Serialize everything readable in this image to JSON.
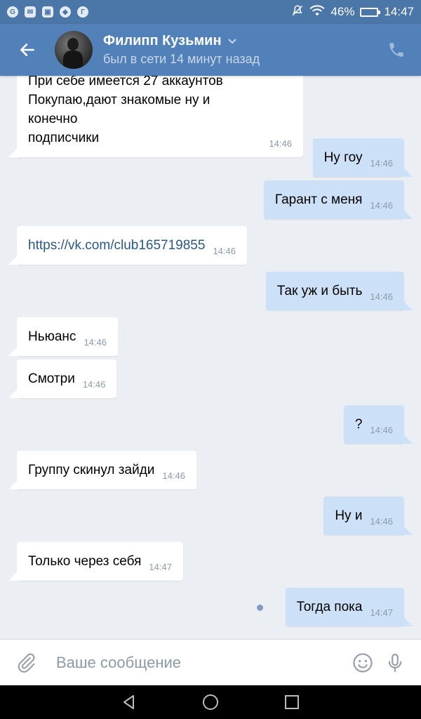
{
  "statusbar": {
    "apps": [
      "G",
      "✉",
      "▣",
      "◆",
      "Г"
    ],
    "battery": "46%",
    "battery_level": 0.46,
    "time": "14:47"
  },
  "header": {
    "name": "Филипп Кузьмин",
    "status": "был в сети 14 минут назад"
  },
  "messages": [
    {
      "dir": "in",
      "lines": [
        "При себе имеется 27 аккаунтов",
        "Покупаю,дают знакомые ну и конечно",
        "подписчики"
      ],
      "time": "14:46"
    },
    {
      "dir": "out",
      "text": "Ну гоу",
      "time": "14:46"
    },
    {
      "dir": "out",
      "text": "Гарант с меня",
      "time": "14:46"
    },
    {
      "dir": "in",
      "text": "https://vk.com/club165719855",
      "time": "14:46",
      "link": true
    },
    {
      "dir": "out",
      "text": "Так уж и быть",
      "time": "14:46"
    },
    {
      "dir": "in",
      "text": "Ньюанс",
      "time": "14:46"
    },
    {
      "dir": "in",
      "text": "Смотри",
      "time": "14:46"
    },
    {
      "dir": "out",
      "text": "?",
      "time": "14:46"
    },
    {
      "dir": "in",
      "text": "Группу скинул зайди",
      "time": "14:46"
    },
    {
      "dir": "out",
      "text": "Ну и",
      "time": "14:46"
    },
    {
      "dir": "in",
      "text": "Только через себя",
      "time": "14:47"
    },
    {
      "dir": "out",
      "text": "Тогда пока",
      "time": "14:47",
      "unread": true
    }
  ],
  "composer": {
    "placeholder": "Ваше сообщение"
  },
  "colors": {
    "header": "#5181b8",
    "statusbar": "#4a76a8",
    "background": "#ebeff4",
    "outgoing": "#cce0f7",
    "incoming": "#ffffff"
  }
}
